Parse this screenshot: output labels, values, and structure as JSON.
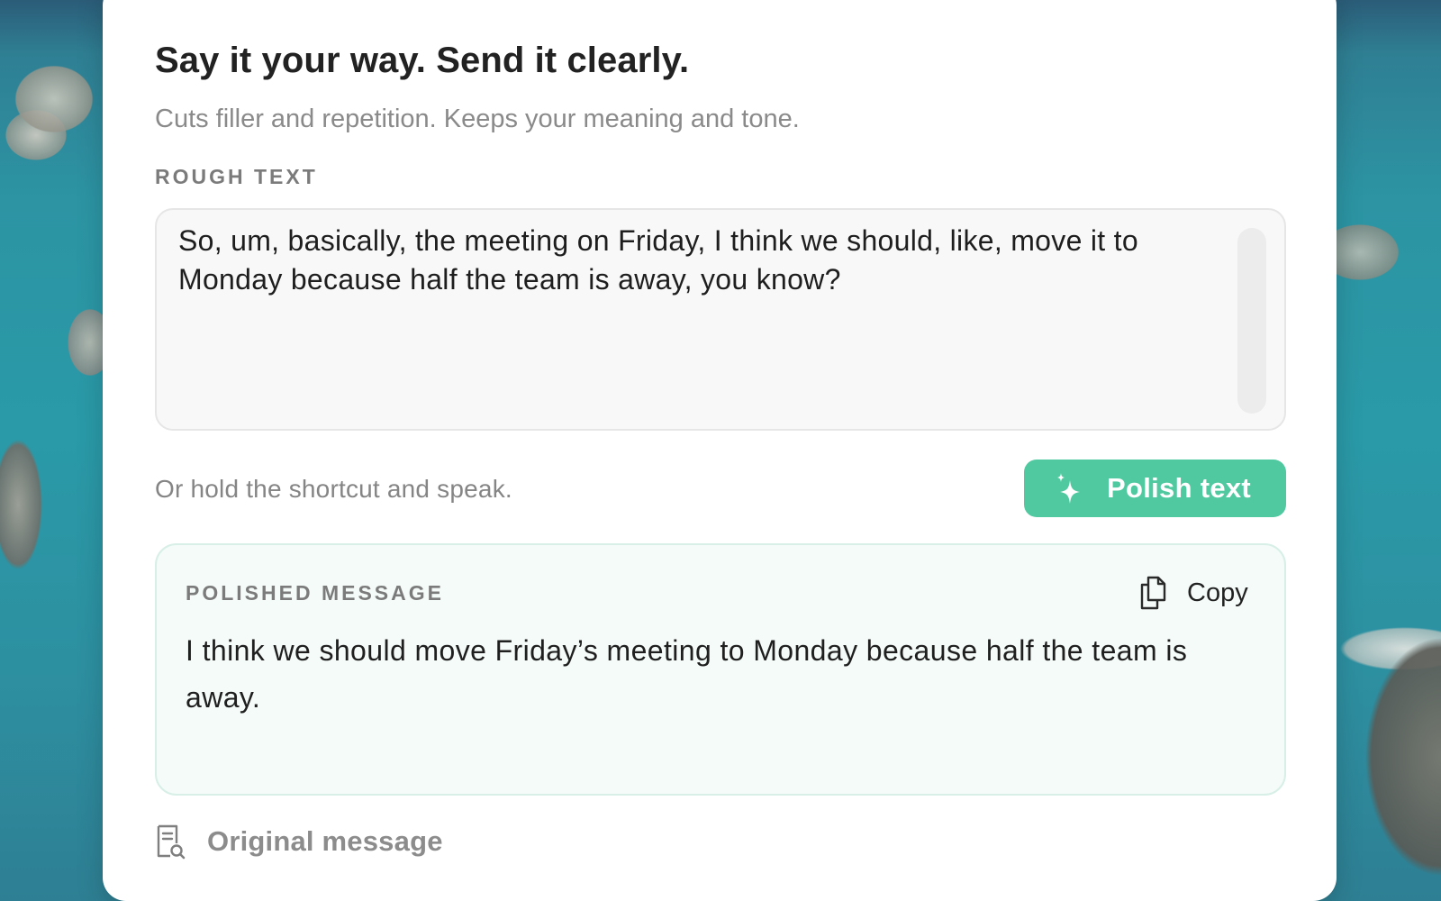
{
  "header": {
    "title": "Say it your way. Send it clearly.",
    "subtitle": "Cuts filler and repetition. Keeps your meaning and tone."
  },
  "rough": {
    "label": "ROUGH TEXT",
    "text": "So, um, basically, the meeting on Friday, I think we should, like, move it to Monday because half the team is away, you know?"
  },
  "actions": {
    "hint": "Or hold the shortcut and speak.",
    "polish_label": "Polish text",
    "polish_icon": "sparkle-icon"
  },
  "polished": {
    "label": "POLISHED MESSAGE",
    "copy_label": "Copy",
    "copy_icon": "copy-icon",
    "text": "I think we should move Friday’s meeting to Monday because half the team is away."
  },
  "footer": {
    "original_label": "Original message",
    "original_icon": "document-search-icon"
  },
  "colors": {
    "accent": "#50c9a0",
    "polished_bg": "#f4fbf9",
    "polished_border": "#d7efe7"
  }
}
